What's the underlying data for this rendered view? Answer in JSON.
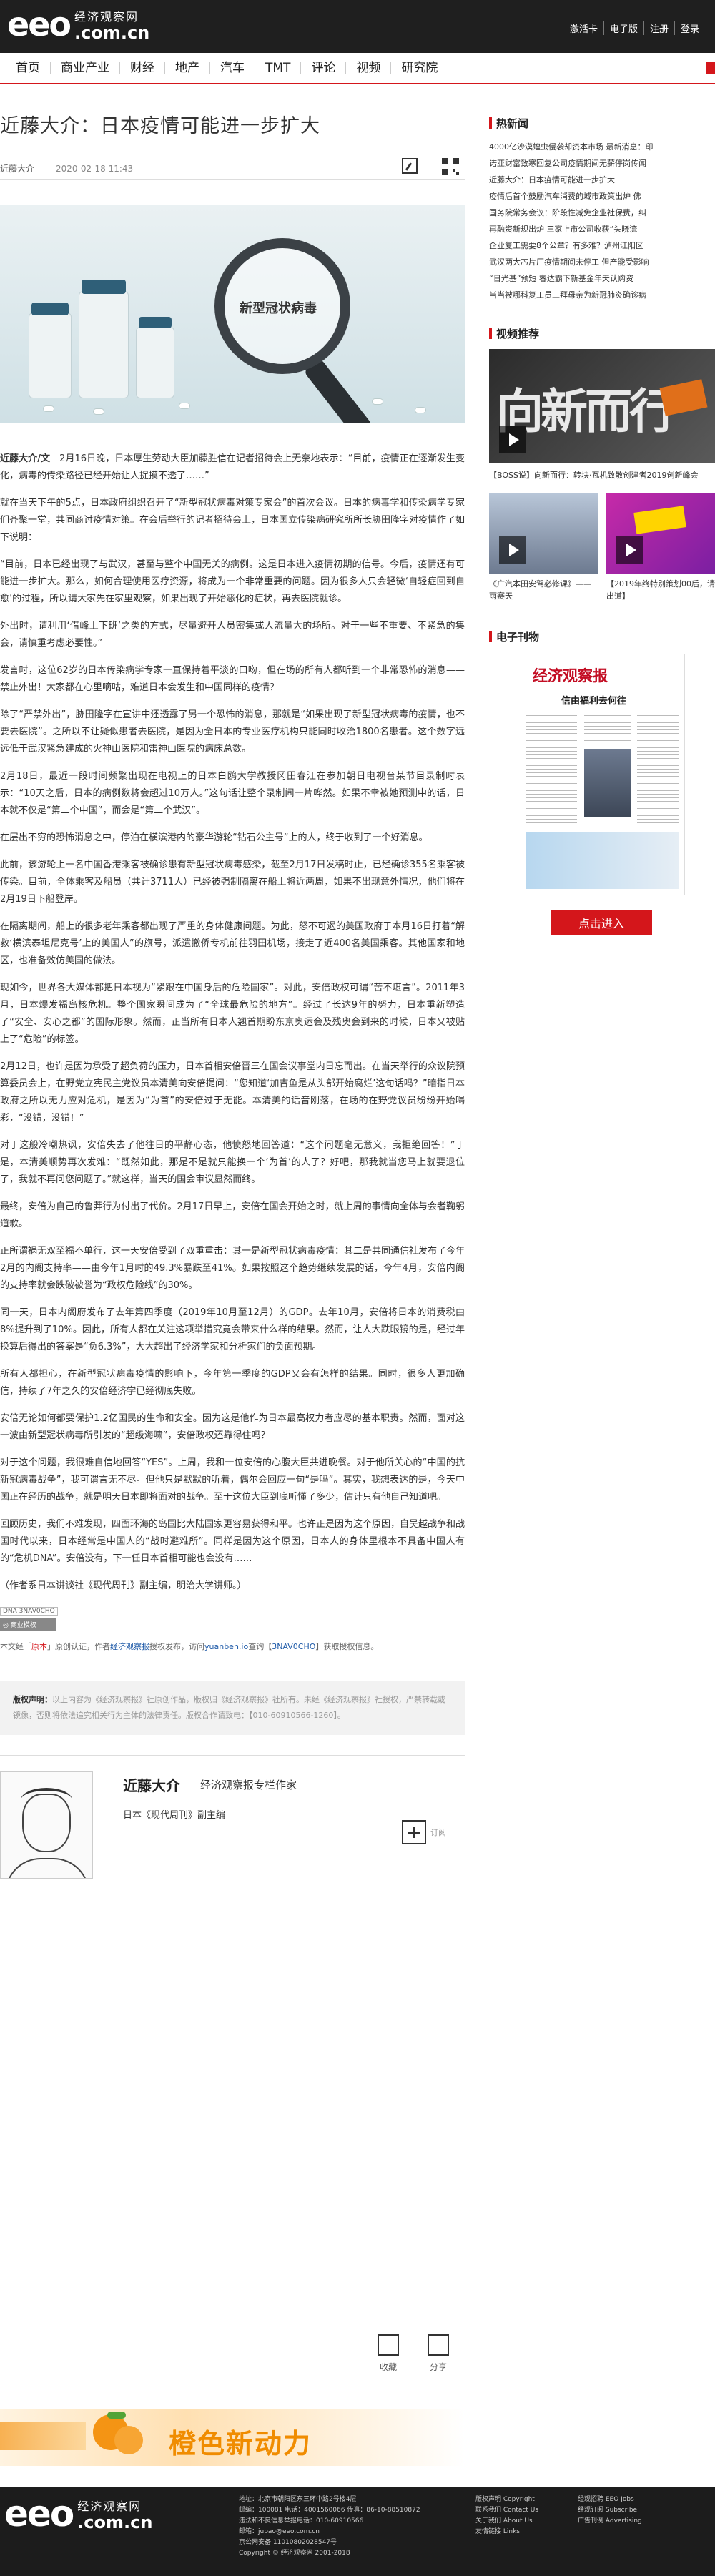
{
  "header": {
    "logo_main": "eeo",
    "logo_cn": "经济观察网",
    "logo_domain": ".com.cn",
    "top_links": [
      "激活卡",
      "电子版",
      "注册",
      "登录"
    ]
  },
  "nav": {
    "items": [
      "首页",
      "商业产业",
      "财经",
      "地产",
      "汽车",
      "TMT",
      "评论",
      "视频",
      "研究院"
    ]
  },
  "article": {
    "title": "近藤大介：日本疫情可能进一步扩大",
    "author": "近藤大介",
    "date": "2020-02-18 11:43",
    "image_label": "新型冠状病毒",
    "paragraphs": [
      {
        "lead": "近藤大介/文",
        "text": "　2月16日晚，日本厚生劳动大臣加藤胜信在记者招待会上无奈地表示：“目前，疫情正在逐渐发生变化，病毒的传染路径已经开始让人捉摸不透了……”"
      },
      {
        "lead": "",
        "text": "就在当天下午的5点，日本政府组织召开了“新型冠状病毒对策专家会”的首次会议。日本的病毒学和传染病学专家们齐聚一堂，共同商讨疫情对策。在会后举行的记者招待会上，日本国立传染病研究所所长胁田隆字对疫情作了如下说明："
      },
      {
        "lead": "",
        "text": "“目前，日本已经出现了与武汉，甚至与整个中国无关的病例。这是日本进入疫情初期的信号。今后，疫情还有可能进一步扩大。那么，如何合理使用医疗资源，将成为一个非常重要的问题。因为很多人只会轻微‘自轻症回到自愈’的过程，所以请大家先在家里观察，如果出现了开始恶化的症状，再去医院就诊。"
      },
      {
        "lead": "",
        "text": "外出时，请利用‘借峰上下班’之类的方式，尽量避开人员密集或人流量大的场所。对于一些不重要、不紧急的集会，请慎重考虑必要性。”"
      },
      {
        "lead": "",
        "text": "发言时，这位62岁的日本传染病学专家一直保持着平淡的口吻，但在场的所有人都听到一个非常恐怖的消息——禁止外出！大家都在心里嘀咕，难道日本会发生和中国同样的疫情？"
      },
      {
        "lead": "",
        "text": "除了“严禁外出”，胁田隆字在宣讲中还透露了另一个恐怖的消息，那就是“如果出现了新型冠状病毒的疫情，也不要去医院”。之所以不让疑似患者去医院，是因为全日本的专业医疗机构只能同时收治1800名患者。这个数字远远低于武汉紧急建成的火神山医院和雷神山医院的病床总数。"
      },
      {
        "lead": "",
        "text": "2月18日，最近一段时间频繁出现在电视上的日本白鸥大学教授冈田春江在参加朝日电视台某节目录制时表示：“10天之后，日本的病例数将会超过10万人。”这句话让整个录制间一片哗然。如果不幸被她预测中的话，日本就不仅是“第二个中国”，而会是“第二个武汉”。"
      },
      {
        "lead": "",
        "text": "在层出不穷的恐怖消息之中，停泊在横滨港内的豪华游轮“钻石公主号”上的人，终于收到了一个好消息。"
      },
      {
        "lead": "",
        "text": "此前，该游轮上一名中国香港乘客被确诊患有新型冠状病毒感染，截至2月17日发稿时止，已经确诊355名乘客被传染。目前，全体乘客及船员（共计3711人）已经被强制隔离在船上将近两周，如果不出现意外情况，他们将在2月19日下船登岸。"
      },
      {
        "lead": "",
        "text": "在隔离期间，船上的很多老年乘客都出现了严重的身体健康问题。为此，怒不可遏的美国政府于本月16日打着“解救‘横滨泰坦尼克号’上的美国人”的旗号，派遣撤侨专机前往羽田机场，接走了近400名美国乘客。其他国家和地区，也准备效仿美国的做法。"
      },
      {
        "lead": "",
        "text": "现如今，世界各大媒体都把日本视为“紧跟在中国身后的危险国家”。对此，安倍政权可谓“苦不堪言”。2011年3月，日本爆发福岛核危机。整个国家瞬间成为了“全球最危险的地方”。经过了长达9年的努力，日本重新塑造了“安全、安心之都”的国际形象。然而，正当所有日本人翘首期盼东京奥运会及残奥会到来的时候，日本又被贴上了“危险”的标签。"
      },
      {
        "lead": "",
        "text": "2月12日，也许是因为承受了超负荷的压力，日本首相安倍晋三在国会议事堂内日忘而出。在当天举行的众议院预算委员会上，在野党立宪民主党议员本清美向安倍提问：“您知道‘加吉鱼是从头部开始腐烂’这句话吗？”暗指日本政府之所以无力应对危机，是因为“为首”的安倍过于无能。本清美的话音刚落，在场的在野党议员纷纷开始喝彩，“没错，没错！”"
      },
      {
        "lead": "",
        "text": "对于这般冷嘲热讽，安倍失去了他往日的平静心态，他愤怒地回答道：“这个问题毫无意义，我拒绝回答！”于是，本清美顺势再次发难：“既然如此，那是不是就只能换一个‘为首’的人了？好吧，那我就当您马上就要退位了，我就不再问您问题了。”就这样，当天的国会审议显然而终。"
      },
      {
        "lead": "",
        "text": "最终，安倍为自己的鲁莽行为付出了代价。2月17日早上，安倍在国会开始之时，就上周的事情向全体与会者鞠躬道歉。"
      },
      {
        "lead": "",
        "text": "正所谓祸无双至福不单行，这一天安倍受到了双重重击：其一是新型冠状病毒疫情：其二是共同通信社发布了今年2月的内阁支持率——由今年1月时的49.3%暴跌至41%。如果按照这个趋势继续发展的话，今年4月，安倍内阁的支持率就会跌破被誉为“政权危险线”的30%。"
      },
      {
        "lead": "",
        "text": "同一天，日本内阁府发布了去年第四季度（2019年10月至12月）的GDP。去年10月，安倍将日本的消费税由8%提升到了10%。因此，所有人都在关注这项举措究竟会带来什么样的结果。然而，让人大跌眼镜的是，经过年换算后得出的答案是“负6.3%”，大大超出了经济学家和分析家们的负面预期。"
      },
      {
        "lead": "",
        "text": "所有人都担心，在新型冠状病毒疫情的影响下，今年第一季度的GDP又会有怎样的结果。同时，很多人更加确信，持续了7年之久的安倍经济学已经彻底失败。"
      },
      {
        "lead": "",
        "text": "安倍无论如何都要保护1.2亿国民的生命和安全。因为这是他作为日本最高权力者应尽的基本职责。然而，面对这一波由新型冠状病毒所引发的“超级海啸”，安倍政权还靠得住吗？"
      },
      {
        "lead": "",
        "text": "对于这个问题，我很难自信地回答“YES”。上周，我和一位安倍的心腹大臣共进晚餐。对于他所关心的“中国的抗新冠病毒战争”，我可谓言无不尽。但他只是默默的听着，偶尔会回应一句“是吗”。其实，我想表达的是，今天中国正在经历的战争，就是明天日本即将面对的战争。至于这位大臣到底听懂了多少，估计只有他自己知道吧。"
      },
      {
        "lead": "",
        "text": "回顾历史，我们不难发现，四面环海的岛国比大陆国家更容易获得和平。也许正是因为这个原因，自吴越战争和战国时代以来，日本经常是中国人的“战时避难所”。同样是因为这个原因，日本人的身体里根本不具备中国人有的“危机DNA”。安倍没有，下一任日本首相可能也会没有……"
      },
      {
        "lead": "",
        "text": "（作者系日本讲谈社《现代周刊》副主编，明治大学讲师。）"
      }
    ],
    "dna_tag": "DNA 3NAV0CHO",
    "dna_tag2": "◎ 商业模权",
    "source_prefix": "本文经「",
    "source_red": "原本",
    "source_mid": "」原创认证，作者",
    "source_blue": "经济观察报",
    "source_mid2": "授权发布，访问",
    "source_url": "yuanben.io",
    "source_mid3": "查询【",
    "source_code": "3NAV0CHO",
    "source_end": "】获取授权信息。",
    "copyright_label": "版权声明：",
    "copyright_text": "以上内容为《经济观察报》社原创作品，版权归《经济观察报》社所有。未经《经济观察报》社授权，严禁转载或镜像，否则将依法追究相关行为主体的法律责任。版权合作请致电：【010-60910566-1260】。"
  },
  "author_card": {
    "name": "近藤大介",
    "role": "经济观察报专栏作家",
    "sub": "日本《现代周刊》副主编",
    "subscribe": "订阅",
    "collect": "收藏",
    "share": "分享"
  },
  "banner": {
    "text": "橙色新动力"
  },
  "sidebar": {
    "hot_title": "热新闻",
    "hot_items": [
      "4000亿沙漠蝗虫侵袭却资本市场 最新消息：印",
      "诺亚财富致寒回复公司疫情期间无薪停岗传闻",
      "近藤大介：日本疫情可能进一步扩大",
      "疫情后首个鼓励汽车消费的城市政策出炉 佛",
      "国务院常务会议：阶段性减免企业社保费，纠",
      "再融资新规出炉 三家上市公司收获“头晓流",
      "企业复工需要8个公章？有多难？泸州江阳区",
      "武汉两大芯片厂疫情期间未停工 但产能受影响",
      "“日光基”预短 睿达霸下新基金年天认购资",
      "当当被哪科复工员工拜母亲为新冠肺炎确诊病"
    ],
    "video_title": "视频推荐",
    "video_main_text": "向新而行",
    "video_main_caption": "【BOSS说】向新而行：转块·瓦机致敬创建者2019创新峰会",
    "video_small": [
      {
        "caption": "《广汽本田安驾必修课》——雨赛天"
      },
      {
        "caption": "【2019年终特别策划00后，请出道】"
      }
    ],
    "paper_title": "电子刊物",
    "paper_masthead": "经济观察报",
    "paper_headline": "信由福利去何往",
    "enter_button": "点击进入"
  },
  "footer": {
    "info_lines": [
      "地址：北京市朝阳区东三环中路2号楼4层",
      "邮编：100081 电话：4001560066 传真：86-10-88510872",
      "违法和不良信息举报电话：010-60910566",
      "邮箱：jubao@eeo.com.cn",
      "京公网安备 11010802028547号",
      "Copyright © 经济观察网 2001-2018"
    ],
    "links1": [
      "版权声明 Copyright",
      "联系我们 Contact Us",
      "关于我们 About Us",
      "友情链接 Links"
    ],
    "links2": [
      "经观招聘 EEO Jobs",
      "经观订阅 Subscribe",
      "广告刊例 Advertising"
    ]
  }
}
